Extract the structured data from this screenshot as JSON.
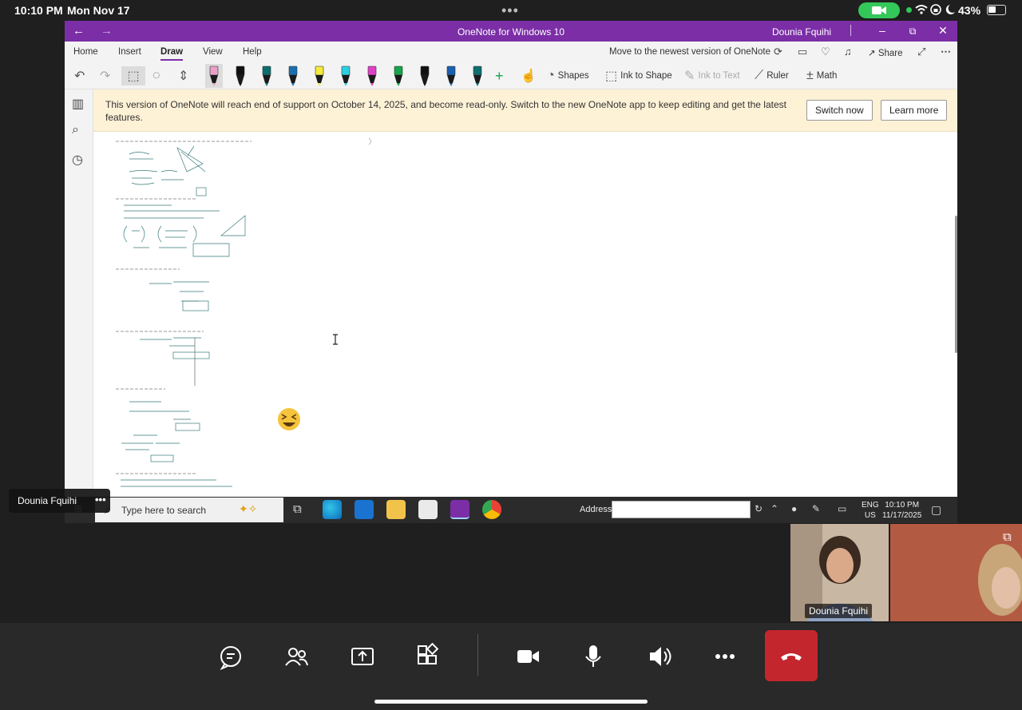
{
  "status_bar": {
    "time": "10:10 PM",
    "date": "Mon Nov 17",
    "battery": "43%",
    "icons": [
      "camera-active-icon",
      "wifi-icon",
      "screen-lock-icon",
      "moon-icon",
      "battery-icon"
    ]
  },
  "window": {
    "title": "OneNote for Windows 10",
    "user": "Dounia Fquihi",
    "titlebar_color": "#7b2ea6"
  },
  "ribbon": {
    "tabs": [
      "Home",
      "Insert",
      "Draw",
      "View",
      "Help"
    ],
    "active_tab": "Draw",
    "move_link": "Move to the newest version of OneNote",
    "share": "Share"
  },
  "toolbar": {
    "shapes": "Shapes",
    "ink_to_shape": "Ink to Shape",
    "ink_to_text": "Ink to Text",
    "ruler": "Ruler",
    "math": "Math",
    "pen_colors": [
      "#e8a0c8",
      "#111111",
      "#0b6e6e",
      "#1a6fb0",
      "#f4e83a",
      "#2ad0e0",
      "#e040c8",
      "#16a34a",
      "#111111",
      "#1a5fb0",
      "#0b6e6e"
    ]
  },
  "banner": {
    "message": "This version of OneNote will reach end of support on October 14, 2025, and become read-only. Switch to the new OneNote app to keep editing and get the latest features.",
    "switch_now": "Switch now",
    "learn_more": "Learn more"
  },
  "taskbar": {
    "search_placeholder": "Type here to search",
    "address_label": "Address",
    "lang_1": "ENG",
    "lang_2": "US",
    "clock_time": "10:10 PM",
    "clock_date": "11/17/2025"
  },
  "call": {
    "presenter_chip": "Dounia Fquihi",
    "presenter_chip_more": "•••",
    "participant_1": "Dounia Fquihi",
    "hangup_color": "#c4262e"
  }
}
